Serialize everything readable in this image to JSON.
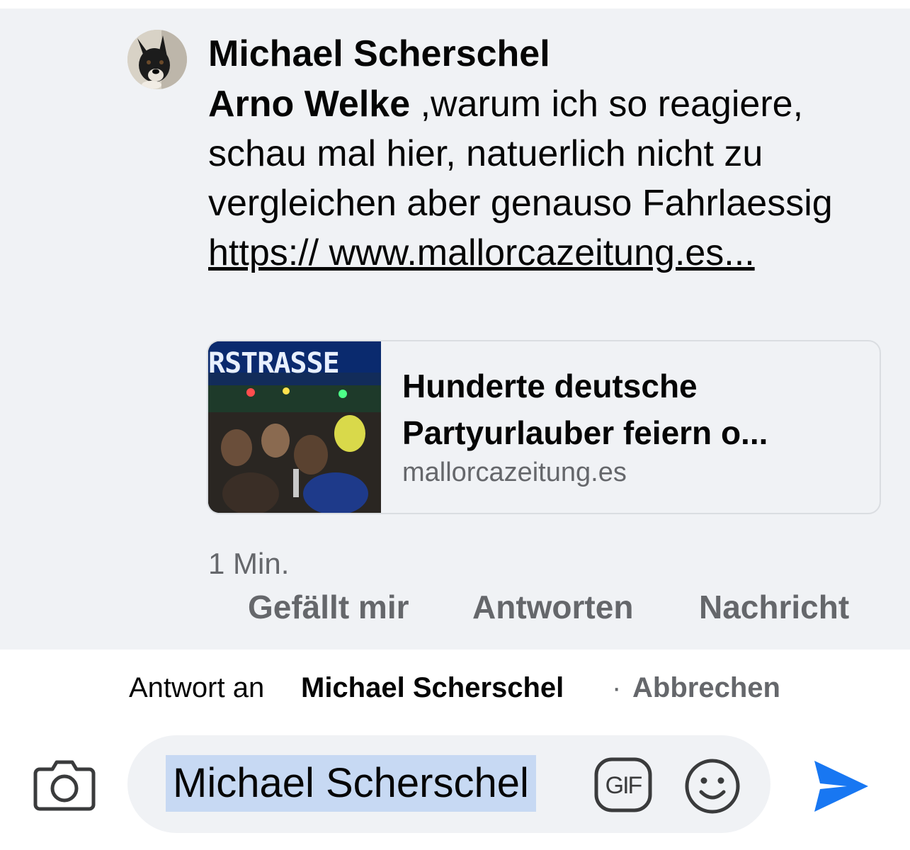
{
  "comment": {
    "author": "Michael Scherschel",
    "avatar_icon": "dog-avatar-icon",
    "mention": "Arno Welke",
    "text_after_mention": " ,warum ich so reagiere, schau mal hier, natuerlich nicht zu vergleichen aber genauso Fahrlaessig ",
    "link_text": "https:// www.mallorcazeitung.es...",
    "link_preview": {
      "title": "Hunderte deutsche Partyurlauber feiern o...",
      "domain": "mallorcazeitung.es",
      "thumbnail_text": "RSTRASSE"
    },
    "timestamp": "1 Min.",
    "actions": {
      "like": "Gefällt mir",
      "reply": "Antworten",
      "message": "Nachricht"
    }
  },
  "reply_bar": {
    "prefix": "Antwort an",
    "name": "Michael Scherschel",
    "separator": "·",
    "cancel": "Abbrechen"
  },
  "composer": {
    "value": "Michael Scherschel",
    "icons": [
      "camera-icon",
      "gif-icon",
      "emoji-icon",
      "send-icon"
    ]
  },
  "colors": {
    "comment_background": "#f0f2f5",
    "secondary_text": "#65676b",
    "mention_highlight": "#c7d9f3",
    "send_blue": "#1877f2"
  }
}
